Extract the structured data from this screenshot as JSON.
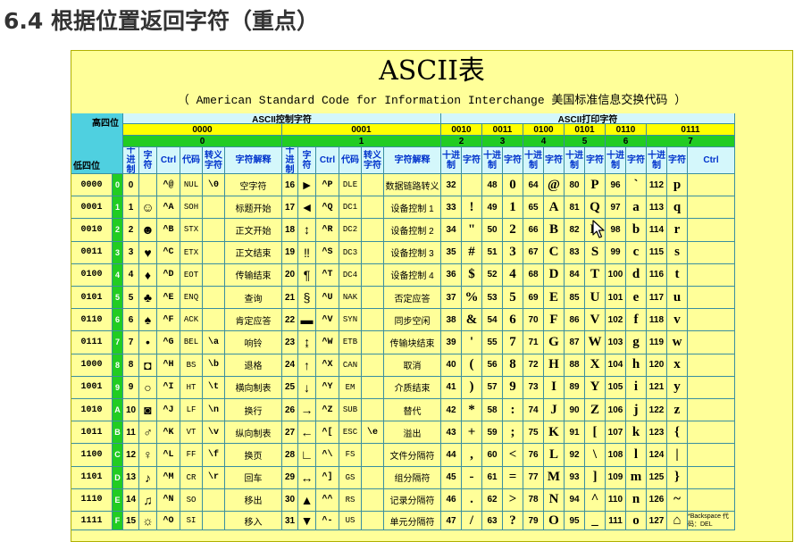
{
  "heading": "6.4 根据位置返回字符（重点）",
  "table": {
    "title": "ASCII表",
    "subtitle": "（ American Standard Code for Information Interchange  美国标准信息交换代码 ）",
    "corner_high": "高四位",
    "corner_low": "低四位",
    "group_control": "ASCII控制字符",
    "group_print": "ASCII打印字符",
    "high_bits": [
      "0000",
      "0001",
      "0010",
      "0011",
      "0100",
      "0101",
      "0110",
      "0111"
    ],
    "high_index": [
      "0",
      "1",
      "2",
      "3",
      "4",
      "5",
      "6",
      "7"
    ],
    "control_headers": [
      "十进制",
      "字符",
      "Ctrl",
      "代码",
      "转义字符",
      "字符解释"
    ],
    "print_headers": [
      "十进制",
      "字符"
    ],
    "last_ctrl_header": "Ctrl",
    "low_bits": [
      "0000",
      "0001",
      "0010",
      "0011",
      "0100",
      "0101",
      "0110",
      "0111",
      "1000",
      "1001",
      "1010",
      "1011",
      "1100",
      "1101",
      "1110",
      "1111"
    ],
    "low_index": [
      "0",
      "1",
      "2",
      "3",
      "4",
      "5",
      "6",
      "7",
      "8",
      "9",
      "A",
      "B",
      "C",
      "D",
      "E",
      "F"
    ],
    "ctrl0": [
      {
        "dec": "0",
        "sym": "",
        "ctrl": "^@",
        "code": "NUL",
        "esc": "\\0",
        "desc": "空字符"
      },
      {
        "dec": "1",
        "sym": "☺",
        "ctrl": "^A",
        "code": "SOH",
        "esc": "",
        "desc": "标题开始"
      },
      {
        "dec": "2",
        "sym": "☻",
        "ctrl": "^B",
        "code": "STX",
        "esc": "",
        "desc": "正文开始"
      },
      {
        "dec": "3",
        "sym": "♥",
        "ctrl": "^C",
        "code": "ETX",
        "esc": "",
        "desc": "正文结束"
      },
      {
        "dec": "4",
        "sym": "♦",
        "ctrl": "^D",
        "code": "EOT",
        "esc": "",
        "desc": "传输结束"
      },
      {
        "dec": "5",
        "sym": "♣",
        "ctrl": "^E",
        "code": "ENQ",
        "esc": "",
        "desc": "查询"
      },
      {
        "dec": "6",
        "sym": "♠",
        "ctrl": "^F",
        "code": "ACK",
        "esc": "",
        "desc": "肯定应答"
      },
      {
        "dec": "7",
        "sym": "•",
        "ctrl": "^G",
        "code": "BEL",
        "esc": "\\a",
        "desc": "响铃"
      },
      {
        "dec": "8",
        "sym": "◘",
        "ctrl": "^H",
        "code": "BS",
        "esc": "\\b",
        "desc": "退格"
      },
      {
        "dec": "9",
        "sym": "○",
        "ctrl": "^I",
        "code": "HT",
        "esc": "\\t",
        "desc": "横向制表"
      },
      {
        "dec": "10",
        "sym": "◙",
        "ctrl": "^J",
        "code": "LF",
        "esc": "\\n",
        "desc": "换行"
      },
      {
        "dec": "11",
        "sym": "♂",
        "ctrl": "^K",
        "code": "VT",
        "esc": "\\v",
        "desc": "纵向制表"
      },
      {
        "dec": "12",
        "sym": "♀",
        "ctrl": "^L",
        "code": "FF",
        "esc": "\\f",
        "desc": "换页"
      },
      {
        "dec": "13",
        "sym": "♪",
        "ctrl": "^M",
        "code": "CR",
        "esc": "\\r",
        "desc": "回车"
      },
      {
        "dec": "14",
        "sym": "♫",
        "ctrl": "^N",
        "code": "SO",
        "esc": "",
        "desc": "移出"
      },
      {
        "dec": "15",
        "sym": "☼",
        "ctrl": "^O",
        "code": "SI",
        "esc": "",
        "desc": "移入"
      }
    ],
    "ctrl1": [
      {
        "dec": "16",
        "sym": "►",
        "ctrl": "^P",
        "code": "DLE",
        "esc": "",
        "desc": "数据链路转义"
      },
      {
        "dec": "17",
        "sym": "◄",
        "ctrl": "^Q",
        "code": "DC1",
        "esc": "",
        "desc": "设备控制 1"
      },
      {
        "dec": "18",
        "sym": "↕",
        "ctrl": "^R",
        "code": "DC2",
        "esc": "",
        "desc": "设备控制 2"
      },
      {
        "dec": "19",
        "sym": "‼",
        "ctrl": "^S",
        "code": "DC3",
        "esc": "",
        "desc": "设备控制 3"
      },
      {
        "dec": "20",
        "sym": "¶",
        "ctrl": "^T",
        "code": "DC4",
        "esc": "",
        "desc": "设备控制 4"
      },
      {
        "dec": "21",
        "sym": "§",
        "ctrl": "^U",
        "code": "NAK",
        "esc": "",
        "desc": "否定应答"
      },
      {
        "dec": "22",
        "sym": "▬",
        "ctrl": "^V",
        "code": "SYN",
        "esc": "",
        "desc": "同步空闲"
      },
      {
        "dec": "23",
        "sym": "↨",
        "ctrl": "^W",
        "code": "ETB",
        "esc": "",
        "desc": "传输块结束"
      },
      {
        "dec": "24",
        "sym": "↑",
        "ctrl": "^X",
        "code": "CAN",
        "esc": "",
        "desc": "取消"
      },
      {
        "dec": "25",
        "sym": "↓",
        "ctrl": "^Y",
        "code": "EM",
        "esc": "",
        "desc": "介质结束"
      },
      {
        "dec": "26",
        "sym": "→",
        "ctrl": "^Z",
        "code": "SUB",
        "esc": "",
        "desc": "替代"
      },
      {
        "dec": "27",
        "sym": "←",
        "ctrl": "^[",
        "code": "ESC",
        "esc": "\\e",
        "desc": "溢出"
      },
      {
        "dec": "28",
        "sym": "∟",
        "ctrl": "^\\",
        "code": "FS",
        "esc": "",
        "desc": "文件分隔符"
      },
      {
        "dec": "29",
        "sym": "↔",
        "ctrl": "^]",
        "code": "GS",
        "esc": "",
        "desc": "组分隔符"
      },
      {
        "dec": "30",
        "sym": "▲",
        "ctrl": "^^",
        "code": "RS",
        "esc": "",
        "desc": "记录分隔符"
      },
      {
        "dec": "31",
        "sym": "▼",
        "ctrl": "^-",
        "code": "US",
        "esc": "",
        "desc": "单元分隔符"
      }
    ],
    "print": [
      [
        [
          "32",
          ""
        ],
        [
          "48",
          "0"
        ],
        [
          "64",
          "@"
        ],
        [
          "80",
          "P"
        ],
        [
          "96",
          "`"
        ],
        [
          "112",
          "p"
        ]
      ],
      [
        [
          "33",
          "!"
        ],
        [
          "49",
          "1"
        ],
        [
          "65",
          "A"
        ],
        [
          "81",
          "Q"
        ],
        [
          "97",
          "a"
        ],
        [
          "113",
          "q"
        ]
      ],
      [
        [
          "34",
          "\""
        ],
        [
          "50",
          "2"
        ],
        [
          "66",
          "B"
        ],
        [
          "82",
          "R"
        ],
        [
          "98",
          "b"
        ],
        [
          "114",
          "r"
        ]
      ],
      [
        [
          "35",
          "#"
        ],
        [
          "51",
          "3"
        ],
        [
          "67",
          "C"
        ],
        [
          "83",
          "S"
        ],
        [
          "99",
          "c"
        ],
        [
          "115",
          "s"
        ]
      ],
      [
        [
          "36",
          "$"
        ],
        [
          "52",
          "4"
        ],
        [
          "68",
          "D"
        ],
        [
          "84",
          "T"
        ],
        [
          "100",
          "d"
        ],
        [
          "116",
          "t"
        ]
      ],
      [
        [
          "37",
          "%"
        ],
        [
          "53",
          "5"
        ],
        [
          "69",
          "E"
        ],
        [
          "85",
          "U"
        ],
        [
          "101",
          "e"
        ],
        [
          "117",
          "u"
        ]
      ],
      [
        [
          "38",
          "&"
        ],
        [
          "54",
          "6"
        ],
        [
          "70",
          "F"
        ],
        [
          "86",
          "V"
        ],
        [
          "102",
          "f"
        ],
        [
          "118",
          "v"
        ]
      ],
      [
        [
          "39",
          "'"
        ],
        [
          "55",
          "7"
        ],
        [
          "71",
          "G"
        ],
        [
          "87",
          "W"
        ],
        [
          "103",
          "g"
        ],
        [
          "119",
          "w"
        ]
      ],
      [
        [
          "40",
          "("
        ],
        [
          "56",
          "8"
        ],
        [
          "72",
          "H"
        ],
        [
          "88",
          "X"
        ],
        [
          "104",
          "h"
        ],
        [
          "120",
          "x"
        ]
      ],
      [
        [
          "41",
          ")"
        ],
        [
          "57",
          "9"
        ],
        [
          "73",
          "I"
        ],
        [
          "89",
          "Y"
        ],
        [
          "105",
          "i"
        ],
        [
          "121",
          "y"
        ]
      ],
      [
        [
          "42",
          "*"
        ],
        [
          "58",
          ":"
        ],
        [
          "74",
          "J"
        ],
        [
          "90",
          "Z"
        ],
        [
          "106",
          "j"
        ],
        [
          "122",
          "z"
        ]
      ],
      [
        [
          "43",
          "+"
        ],
        [
          "59",
          ";"
        ],
        [
          "75",
          "K"
        ],
        [
          "91",
          "["
        ],
        [
          "107",
          "k"
        ],
        [
          "123",
          "{"
        ]
      ],
      [
        [
          "44",
          ","
        ],
        [
          "60",
          "<"
        ],
        [
          "76",
          "L"
        ],
        [
          "92",
          "\\"
        ],
        [
          "108",
          "l"
        ],
        [
          "124",
          "|"
        ]
      ],
      [
        [
          "45",
          "-"
        ],
        [
          "61",
          "="
        ],
        [
          "77",
          "M"
        ],
        [
          "93",
          "]"
        ],
        [
          "109",
          "m"
        ],
        [
          "125",
          "}"
        ]
      ],
      [
        [
          "46",
          "."
        ],
        [
          "62",
          ">"
        ],
        [
          "78",
          "N"
        ],
        [
          "94",
          "^"
        ],
        [
          "110",
          "n"
        ],
        [
          "126",
          "~"
        ]
      ],
      [
        [
          "47",
          "/"
        ],
        [
          "63",
          "?"
        ],
        [
          "79",
          "O"
        ],
        [
          "95",
          "_"
        ],
        [
          "111",
          "o"
        ],
        [
          "127",
          "⌂"
        ]
      ]
    ],
    "ctrl7_last": "*Backspace 代码：DEL"
  }
}
